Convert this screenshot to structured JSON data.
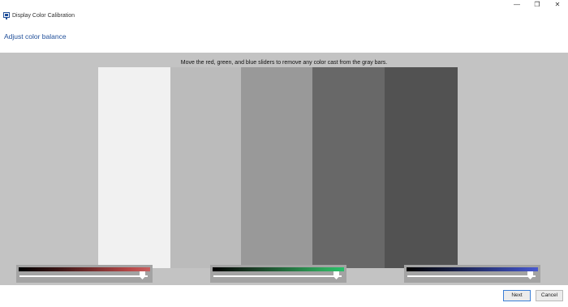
{
  "window": {
    "title": "Display Color Calibration",
    "icon": "display-calibration-icon",
    "controls": {
      "minimize": "—",
      "maximize": "❐",
      "close": "✕"
    }
  },
  "page": {
    "heading": "Adjust color balance",
    "instruction": "Move the red, green, and blue sliders to remove any color cast from the gray bars."
  },
  "gray_bars": [
    {
      "color": "#f1f1f1"
    },
    {
      "color": "#bbbbbb"
    },
    {
      "color": "#999999"
    },
    {
      "color": "#686868"
    },
    {
      "color": "#525252"
    }
  ],
  "sliders": [
    {
      "name": "red",
      "accent": "#c85858",
      "level": 0.98
    },
    {
      "name": "green",
      "accent": "#26c06a",
      "level": 0.98
    },
    {
      "name": "blue",
      "accent": "#4a5ad0",
      "level": 0.98
    }
  ],
  "footer": {
    "next_label": "Next",
    "cancel_label": "Cancel"
  }
}
